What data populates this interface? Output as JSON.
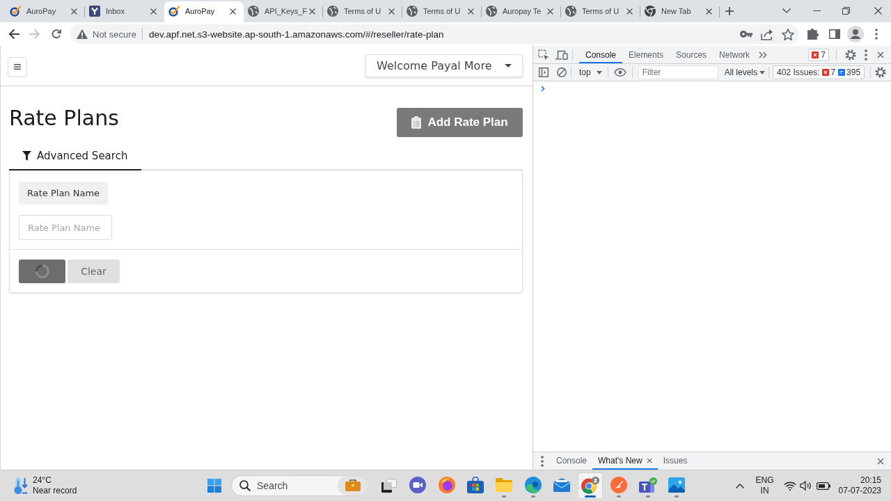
{
  "browser": {
    "tabs": [
      {
        "title": "AuroPay",
        "kind": "auropay",
        "selected": false
      },
      {
        "title": "Inbox",
        "kind": "yahoo",
        "selected": false
      },
      {
        "title": "AuroPay",
        "kind": "auropay",
        "selected": true
      },
      {
        "title": "API_Keys_F",
        "kind": "globe",
        "selected": false
      },
      {
        "title": "Terms of U",
        "kind": "globe",
        "selected": false
      },
      {
        "title": "Terms of U",
        "kind": "globe",
        "selected": false
      },
      {
        "title": "Auropay Te",
        "kind": "globe",
        "selected": false
      },
      {
        "title": "Terms of U",
        "kind": "globe",
        "selected": false
      },
      {
        "title": "New Tab",
        "kind": "chrome",
        "selected": false
      }
    ],
    "forward_button": {
      "disabled": true
    },
    "address_bar": {
      "security": "Not secure",
      "url": "dev.apf.net.s3-website.ap-south-1.amazonaws.com/#/reseller/rate-plan"
    }
  },
  "page": {
    "user_menu": "Welcome Payal More",
    "title": "Rate Plans",
    "add_button": "Add Rate Plan",
    "search_tabs": [
      {
        "label": "Advanced Search",
        "selected": true
      }
    ],
    "filters": [
      {
        "label": "Rate Plan Name",
        "placeholder": "Rate Plan Name"
      }
    ],
    "search_button": {
      "loading": true
    },
    "clear_button": "Clear"
  },
  "devtools": {
    "tabs": [
      {
        "label": "Console",
        "selected": true
      },
      {
        "label": "Elements",
        "selected": false
      },
      {
        "label": "Sources",
        "selected": false
      },
      {
        "label": "Network",
        "selected": false
      }
    ],
    "error_count": "7",
    "context": "top",
    "filter": {
      "placeholder": "Filter"
    },
    "levels": "All levels",
    "issues": {
      "label": "402 Issues:",
      "errors": "7",
      "infos": "395"
    },
    "drawer_tabs": [
      {
        "label": "Console",
        "selected": false,
        "closable": false
      },
      {
        "label": "What's New",
        "selected": true,
        "closable": true
      },
      {
        "label": "Issues",
        "selected": false,
        "closable": false
      }
    ]
  },
  "taskbar": {
    "weather": {
      "temperature": "24°C",
      "condition": "Near record"
    },
    "search": {
      "placeholder": "Search"
    },
    "apps": [
      {
        "kind": "meet",
        "running": false,
        "selected": false
      },
      {
        "kind": "firefox",
        "running": false,
        "selected": false
      },
      {
        "kind": "store",
        "running": false,
        "selected": false
      },
      {
        "kind": "explorer",
        "running": true,
        "selected": false
      },
      {
        "kind": "edge",
        "running": true,
        "selected": false
      },
      {
        "kind": "mail",
        "running": false,
        "selected": false
      },
      {
        "kind": "chrome",
        "running": true,
        "selected": true
      },
      {
        "kind": "postman",
        "running": true,
        "selected": false
      },
      {
        "kind": "teams",
        "running": true,
        "selected": false
      },
      {
        "kind": "photos",
        "running": true,
        "selected": false
      }
    ],
    "tray": {
      "language": "ENG",
      "region": "IN",
      "time": "20:15",
      "date": "07-07-2023"
    }
  }
}
